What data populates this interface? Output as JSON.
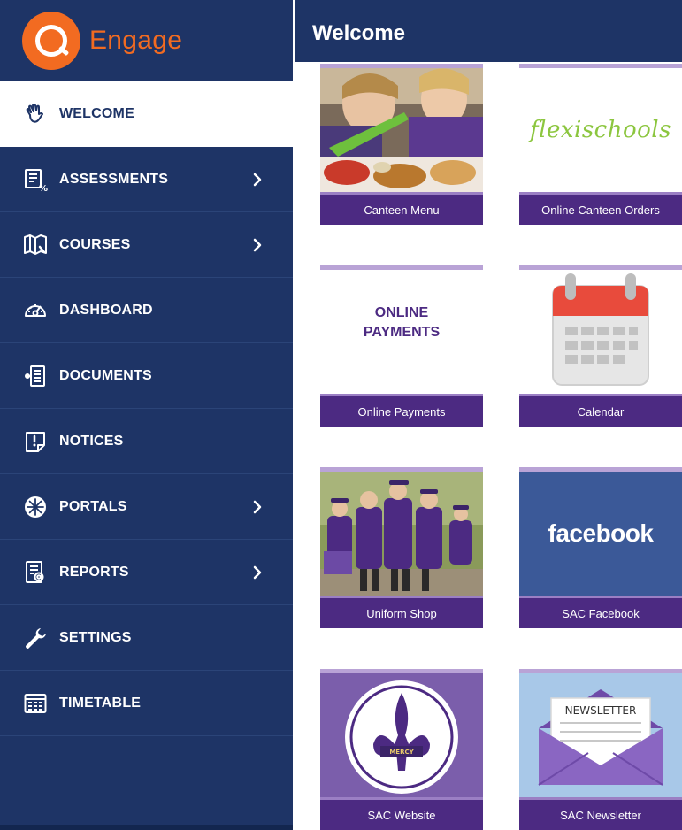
{
  "app": {
    "name": "Engage"
  },
  "header": {
    "title": "Welcome"
  },
  "sidebar": {
    "items": [
      {
        "label": "WELCOME",
        "icon": "hand-wave-icon",
        "active": true,
        "has_submenu": false
      },
      {
        "label": "ASSESSMENTS",
        "icon": "assessments-icon",
        "has_submenu": true
      },
      {
        "label": "COURSES",
        "icon": "book-icon",
        "has_submenu": true
      },
      {
        "label": "DASHBOARD",
        "icon": "gauge-icon",
        "has_submenu": false
      },
      {
        "label": "DOCUMENTS",
        "icon": "document-icon",
        "has_submenu": false
      },
      {
        "label": "NOTICES",
        "icon": "notice-icon",
        "has_submenu": false
      },
      {
        "label": "PORTALS",
        "icon": "portal-icon",
        "has_submenu": true
      },
      {
        "label": "REPORTS",
        "icon": "report-icon",
        "has_submenu": true
      },
      {
        "label": "SETTINGS",
        "icon": "wrench-icon",
        "has_submenu": false
      },
      {
        "label": "TIMETABLE",
        "icon": "calendar-grid-icon",
        "has_submenu": false
      }
    ]
  },
  "tiles": [
    {
      "caption": "Canteen Menu",
      "image": "canteen-photo"
    },
    {
      "caption": "Online Canteen Orders",
      "image": "flexischools-logo",
      "logo_text": "flexischools"
    },
    {
      "caption": "Online Payments",
      "image": "online-payments-text",
      "image_text_line1": "ONLINE",
      "image_text_line2": "PAYMENTS"
    },
    {
      "caption": "Calendar",
      "image": "calendar-icon"
    },
    {
      "caption": "Uniform Shop",
      "image": "students-photo"
    },
    {
      "caption": "SAC Facebook",
      "image": "facebook-logo",
      "logo_text": "facebook"
    },
    {
      "caption": "SAC Website",
      "image": "school-crest",
      "crest_text": "MERCY"
    },
    {
      "caption": "SAC Newsletter",
      "image": "newsletter-envelope",
      "image_text": "NEWSLETTER"
    }
  ],
  "colors": {
    "sidebar_bg": "#1e3466",
    "brand_orange": "#f26b21",
    "caption_purple": "#4c2a82",
    "tile_accent": "#b9a3d6",
    "flexischools_green": "#8cc63f",
    "facebook_blue": "#3b5998"
  }
}
